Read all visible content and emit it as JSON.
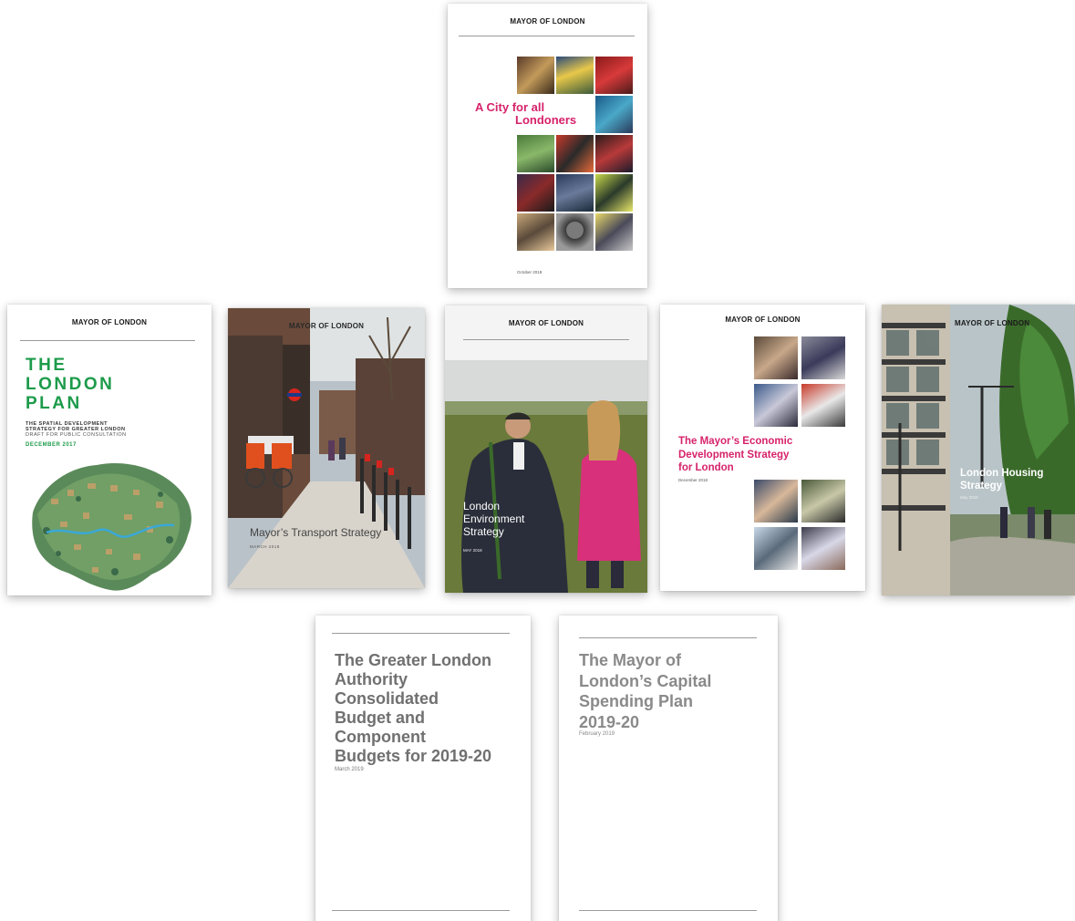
{
  "covers": {
    "city_for_all": {
      "publisher": "MAYOR OF LONDON",
      "title_line1": "A City for all",
      "title_line2": "Londoners",
      "date": "October 2018"
    },
    "london_plan": {
      "publisher": "MAYOR OF LONDON",
      "title_line1": "THE",
      "title_line2": "LONDON",
      "title_line3": "PLAN",
      "subtitle_line1": "THE SPATIAL DEVELOPMENT",
      "subtitle_line2": "STRATEGY FOR GREATER LONDON",
      "subtitle_line3": "DRAFT FOR PUBLIC CONSULTATION",
      "date": "DECEMBER 2017"
    },
    "transport": {
      "publisher": "MAYOR OF LONDON",
      "title": "Mayor’s Transport Strategy",
      "date": "MARCH 2018"
    },
    "environment": {
      "publisher": "MAYOR OF LONDON",
      "title_line1": "London",
      "title_line2": "Environment",
      "title_line3": "Strategy",
      "date": "MAY 2018"
    },
    "economic": {
      "publisher": "MAYOR OF LONDON",
      "title_line1": "The Mayor’s Economic",
      "title_line2": "Development Strategy",
      "title_line3": "for London",
      "date": "December 2018"
    },
    "housing": {
      "publisher": "MAYOR OF LONDON",
      "title_line1": "London Housing",
      "title_line2": "Strategy",
      "date": "May 2018"
    },
    "gla_budget": {
      "title_line1": "The Greater London",
      "title_line2": "Authority",
      "title_line3": "Consolidated",
      "title_line4": "Budget and",
      "title_line5": "Component",
      "title_line6": "Budgets for 2019-20",
      "date": "March 2019"
    },
    "capital_spending": {
      "title_line1": "The Mayor of",
      "title_line2": "London’s Capital",
      "title_line3": "Spending Plan",
      "title_line4": "2019-20",
      "date": "February 2019"
    }
  },
  "colors": {
    "magenta_title": "#d6226b",
    "plan_green": "#1d9b4a",
    "grey_title": "#707070"
  }
}
